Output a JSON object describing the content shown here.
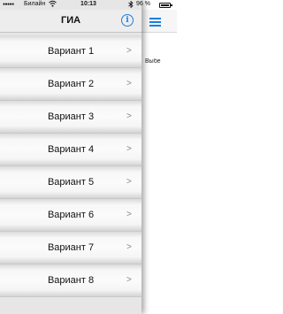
{
  "status_bar": {
    "signal": "●●●●●",
    "carrier": "Билайн",
    "wifi_icon": "wifi-icon",
    "time": "10:13",
    "bluetooth_icon": "bluetooth-icon",
    "battery_percent": "96 %",
    "battery_level": 0.96
  },
  "menu": {
    "title": "ГИА",
    "info_icon_glyph": "i",
    "items": [
      {
        "label": "Вариант 1",
        "chevron": ">"
      },
      {
        "label": "Вариант 2",
        "chevron": ">"
      },
      {
        "label": "Вариант 3",
        "chevron": ">"
      },
      {
        "label": "Вариант 4",
        "chevron": ">"
      },
      {
        "label": "Вариант 5",
        "chevron": ">"
      },
      {
        "label": "Вариант 6",
        "chevron": ">"
      },
      {
        "label": "Вариант 7",
        "chevron": ">"
      },
      {
        "label": "Вариант 8",
        "chevron": ">"
      }
    ]
  },
  "main": {
    "menu_icon": "hamburger-menu-icon",
    "hint_text": "Выбе"
  },
  "colors": {
    "accent": "#1a7fe0",
    "menu_background": "#e6e6e6",
    "chevron": "#888888"
  }
}
